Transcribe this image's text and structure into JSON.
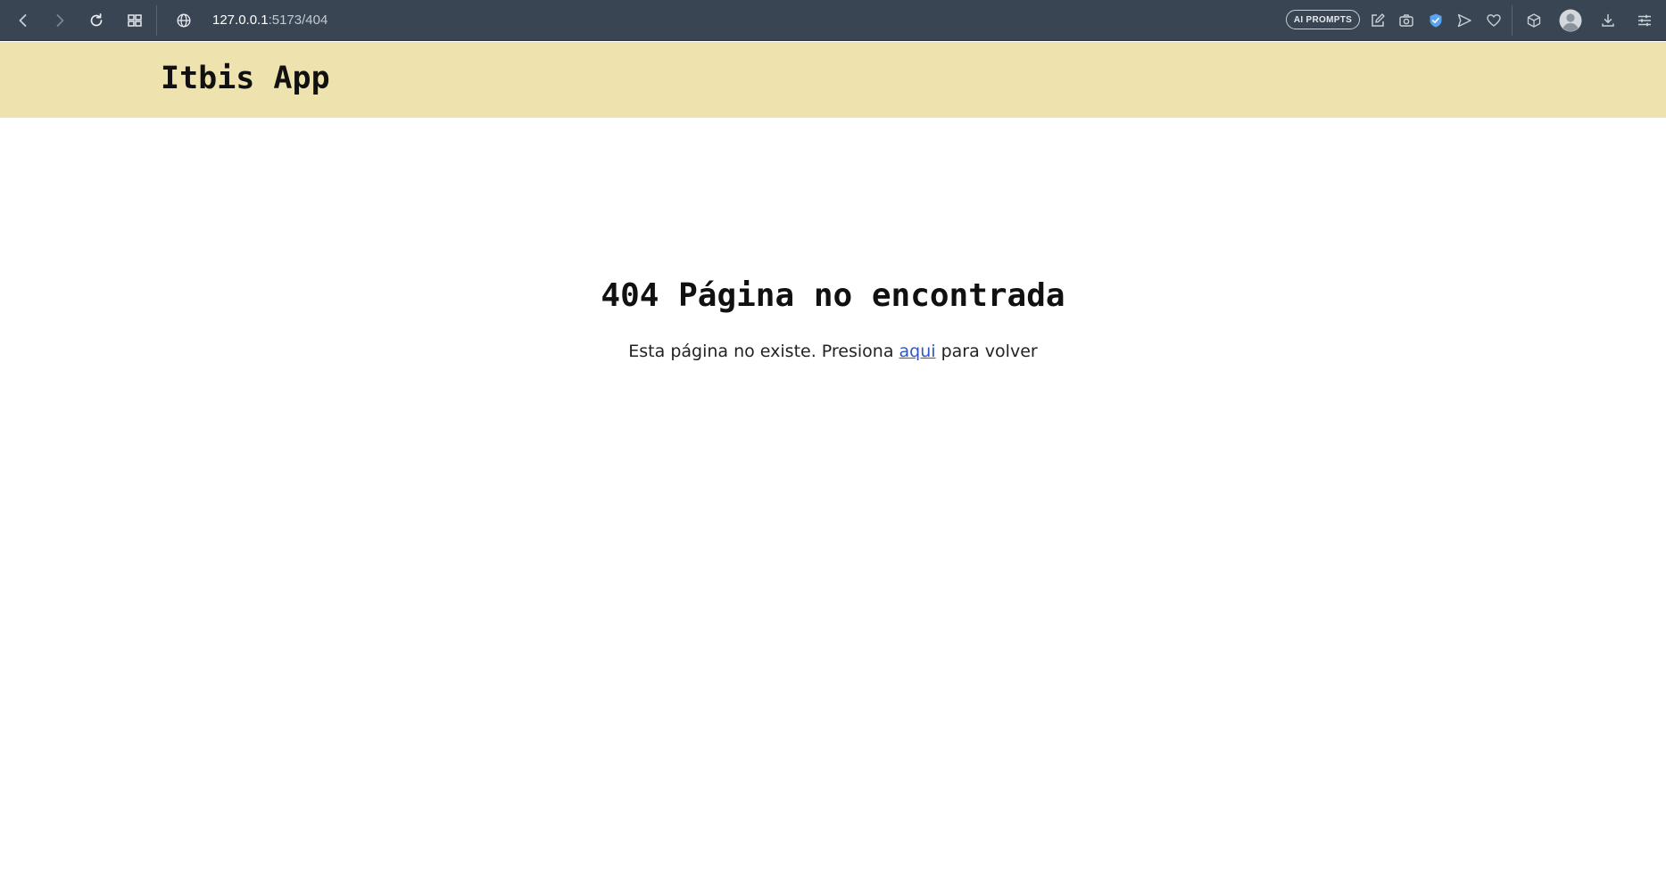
{
  "browser": {
    "url_host": "127.0.0.1",
    "url_path": ":5173/404",
    "ai_prompts_label": "AI PROMPTS",
    "icons": [
      "back-icon",
      "forward-icon",
      "reload-icon",
      "tabs-grid-icon",
      "globe-icon",
      "edit-icon",
      "camera-icon",
      "shield-icon",
      "send-icon",
      "heart-icon",
      "box-icon",
      "profile-avatar-icon",
      "download-icon",
      "settings-sliders-icon"
    ],
    "colors": {
      "toolbar_bg": "#3a4553",
      "shield_accent": "#5aa4f0"
    }
  },
  "header": {
    "title": "Itbis App",
    "bg_color": "#eee3ae"
  },
  "main": {
    "heading": "404 Página no encontrada",
    "message_before": "Esta página no existe. Presiona ",
    "link_text": "aqui",
    "message_after": " para volver",
    "link_color": "#2f56c9"
  }
}
